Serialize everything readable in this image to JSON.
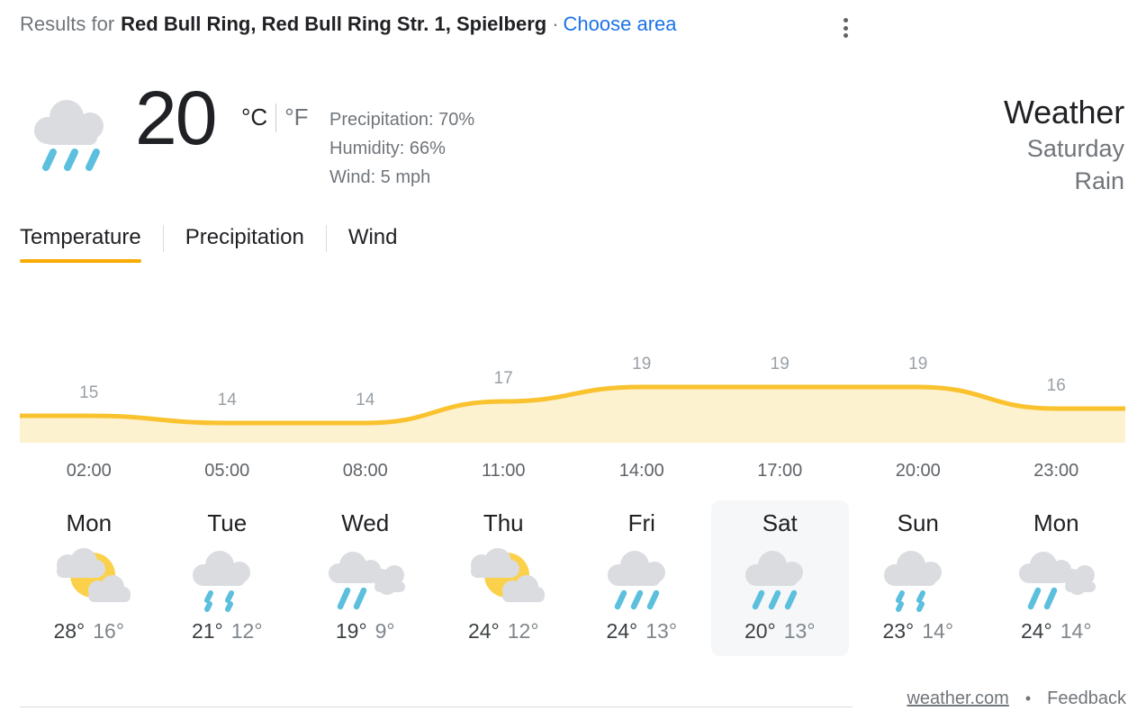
{
  "header": {
    "results_prefix": "Results for",
    "place": "Red Bull Ring, Red Bull Ring Str. 1, Spielberg",
    "separator": "·",
    "choose_area": "Choose area",
    "menu_icon": "kebab-menu-icon"
  },
  "current": {
    "condition_icon": "rain-icon",
    "temperature": "20",
    "unit_celsius": "°C",
    "unit_fahrenheit": "°F",
    "selected_unit": "°C",
    "precipitation": "Precipitation: 70%",
    "humidity": "Humidity: 66%",
    "wind": "Wind: 5 mph",
    "panel_title": "Weather",
    "day": "Saturday",
    "condition": "Rain"
  },
  "tabs": [
    {
      "label": "Temperature",
      "active": true
    },
    {
      "label": "Precipitation",
      "active": false
    },
    {
      "label": "Wind",
      "active": false
    }
  ],
  "chart_data": {
    "type": "line",
    "title": "Temperature",
    "xlabel": "",
    "ylabel": "°C",
    "categories": [
      "02:00",
      "05:00",
      "08:00",
      "11:00",
      "14:00",
      "17:00",
      "20:00",
      "23:00"
    ],
    "values": [
      15,
      14,
      14,
      17,
      19,
      19,
      19,
      16
    ],
    "ylim": [
      13,
      20
    ],
    "grid": false,
    "legend": "none",
    "line_color": "#f9c22e",
    "fill_color": "#fdf2cf",
    "label_color": "#9aa0a6"
  },
  "hours": [
    "02:00",
    "05:00",
    "08:00",
    "11:00",
    "14:00",
    "17:00",
    "20:00",
    "23:00"
  ],
  "days": [
    {
      "name": "Mon",
      "icon": "partly-sunny-icon",
      "high": "28°",
      "low": "16°",
      "selected": false
    },
    {
      "name": "Tue",
      "icon": "light-rain-icon",
      "high": "21°",
      "low": "12°",
      "selected": false
    },
    {
      "name": "Wed",
      "icon": "scattered-showers-icon",
      "high": "19°",
      "low": "9°",
      "selected": false
    },
    {
      "name": "Thu",
      "icon": "partly-sunny-icon",
      "high": "24°",
      "low": "12°",
      "selected": false
    },
    {
      "name": "Fri",
      "icon": "rain-icon",
      "high": "24°",
      "low": "13°",
      "selected": false
    },
    {
      "name": "Sat",
      "icon": "rain-icon",
      "high": "20°",
      "low": "13°",
      "selected": true
    },
    {
      "name": "Sun",
      "icon": "light-rain-icon",
      "high": "23°",
      "low": "14°",
      "selected": false
    },
    {
      "name": "Mon",
      "icon": "scattered-showers-icon",
      "high": "24°",
      "low": "14°",
      "selected": false
    }
  ],
  "footer": {
    "source": "weather.com",
    "separator": "•",
    "feedback": "Feedback"
  },
  "colors": {
    "accent": "#f9ab00",
    "link": "#1a73e8",
    "cloud": "#dadce0",
    "raindrop": "#5bbfdd",
    "sun": "#fbd14b",
    "text": "#202124",
    "muted": "#70757a",
    "selected_bg": "#f6f7f8"
  }
}
